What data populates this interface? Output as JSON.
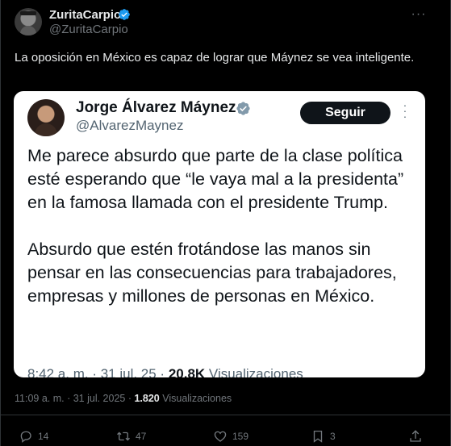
{
  "author": {
    "name": "ZuritaCarpio",
    "handle": "@ZuritaCarpio"
  },
  "tweet": {
    "text": "La oposición en México es capaz de lograr que Máynez se vea inteligente."
  },
  "embedded": {
    "name": "Jorge Álvarez Máynez",
    "handle": "@AlvarezMaynez",
    "follow_label": "Seguir",
    "paragraphs": [
      "Me parece absurdo que parte de la clase política esté esperando que “le vaya mal a la presidenta” en la famosa llamada con el presidente Trump.",
      "Absurdo que estén frotándose las manos sin pensar en las consecuencias para trabajadores, empresas y millones de personas en México."
    ],
    "meta_time": "8:42 a. m. · 31 jul. 25 · ",
    "meta_views": "20.8K",
    "meta_views_label": " Visualizaciones"
  },
  "timestamp": {
    "time": "11:09 a. m. · 31 jul. 2025 · ",
    "views": "1.820",
    "views_label": " Visualizaciones"
  },
  "actions": {
    "replies": "14",
    "retweets": "47",
    "likes": "159",
    "bookmarks": "3"
  },
  "colors": {
    "verified": "#1d9bf0",
    "background": "#000000",
    "muted": "#71767b"
  },
  "icons": [
    "verified-badge-icon",
    "more-icon",
    "reply-icon",
    "retweet-icon",
    "like-icon",
    "bookmark-icon",
    "share-icon"
  ]
}
